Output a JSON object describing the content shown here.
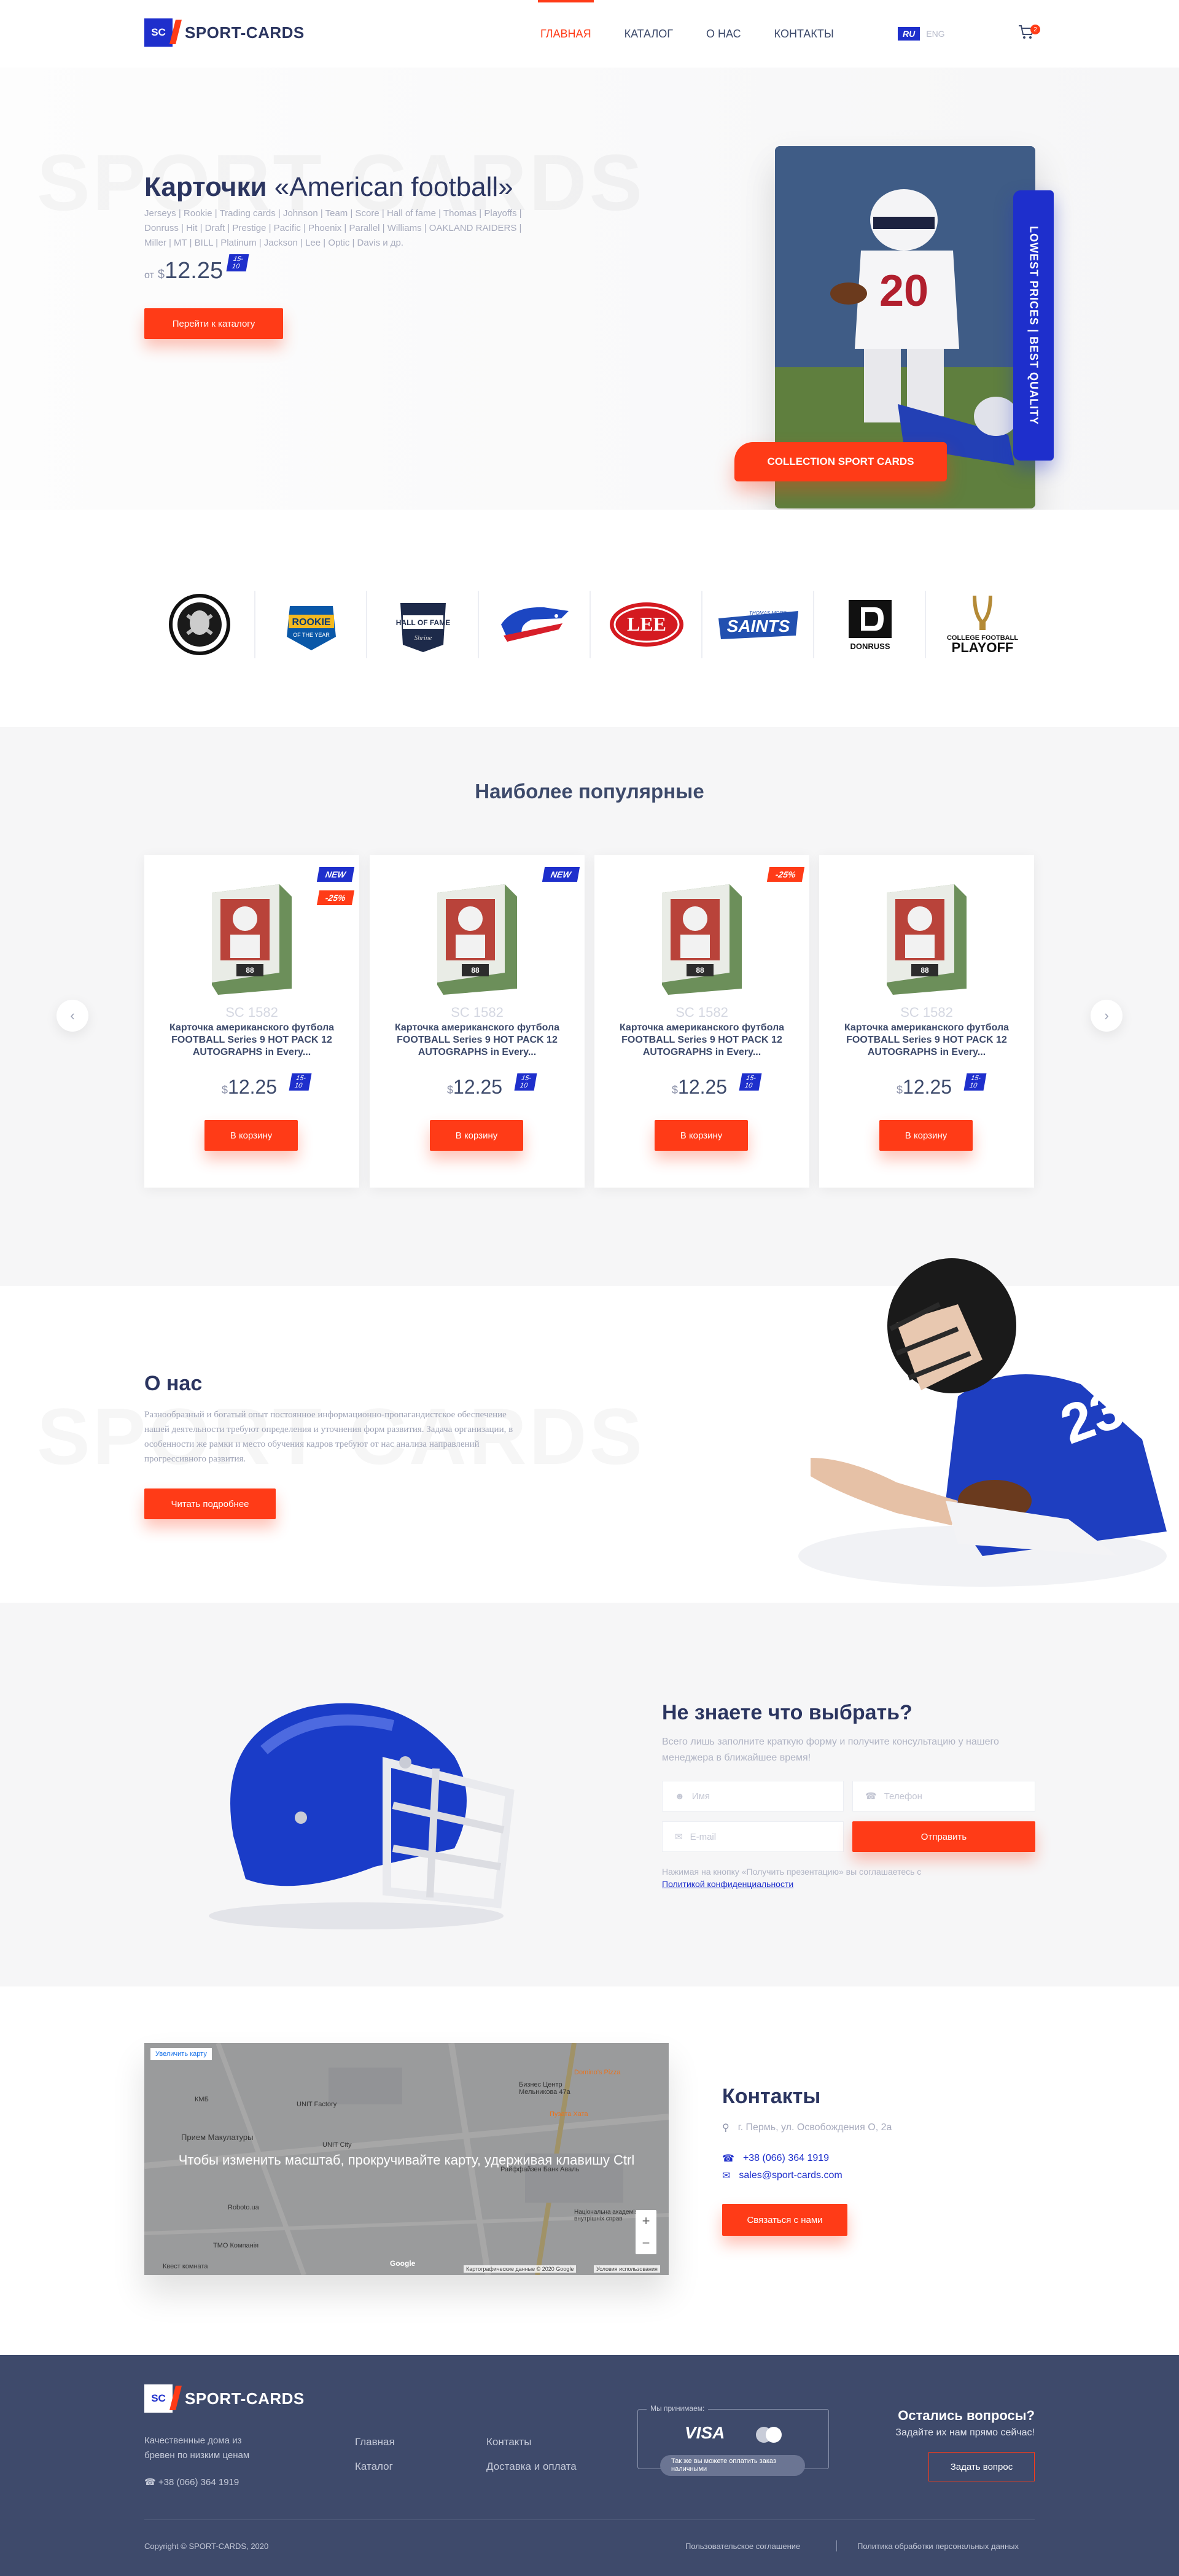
{
  "header": {
    "logo_mark": "SC",
    "logo_text": "SPORT-CARDS",
    "nav": [
      "ГЛАВНАЯ",
      "КАТАЛОГ",
      "О НАС",
      "КОНТАКТЫ"
    ],
    "active_nav": "ГЛАВНАЯ",
    "lang_active": "RU",
    "lang_inactive": "ENG",
    "cart_count": "2",
    "colors": {
      "accent": "#ff3b17",
      "brand": "#1e2fcc",
      "text": "#3d4a6b"
    }
  },
  "hero": {
    "bg_word": "SPORT CARDS",
    "title": "Карточки",
    "title_quote": "«American football»",
    "tags": "Jerseys | Rookie | Trading cards | Johnson | Team | Score | Hall of fame | Thomas | Playoffs | Donruss | Hit | Draft | Prestige | Pacific | Phoenix | Parallel | Williams | OAKLAND RAIDERS | Miller | MT | BILL | Platinum | Jackson | Lee | Optic | Davis и др.",
    "price_from": "от",
    "price_currency": "$",
    "price_value": "12.25",
    "price_tag": "15-10",
    "button": "Перейти к каталогу",
    "badge_vertical": "LOWEST PRICES | BEST QUALITY",
    "collection_button": "COLLECTION SPORT CARDS"
  },
  "brands": [
    {
      "name": "RAIDERS",
      "icon": "raiders-logo"
    },
    {
      "name": "ROOKIE OF THE YEAR",
      "icon": "rookie-logo"
    },
    {
      "name": "HALL OF FAME",
      "icon": "hall-of-fame-logo"
    },
    {
      "name": "BILLS",
      "icon": "bills-logo"
    },
    {
      "name": "LEE",
      "icon": "lee-logo"
    },
    {
      "name": "SAINTS",
      "icon": "saints-logo"
    },
    {
      "name": "DONRUSS",
      "icon": "donruss-logo"
    },
    {
      "name": "COLLEGE FOOTBALL PLAYOFF",
      "icon": "cfp-logo"
    }
  ],
  "popular": {
    "title": "Наиболее популярные",
    "products": [
      {
        "sku": "SC 1582",
        "name": "Карточка американского футбола FOOTBALL Series 9 HOT PACK 12 AUTOGRAPHS in Every...",
        "currency": "$",
        "price": "12.25",
        "tag": "15-10",
        "badges": [
          "NEW",
          "-25%"
        ],
        "button": "В корзину"
      },
      {
        "sku": "SC 1582",
        "name": "Карточка американского футбола FOOTBALL Series 9 HOT PACK 12 AUTOGRAPHS in Every...",
        "currency": "$",
        "price": "12.25",
        "tag": "15-10",
        "badges": [
          "NEW"
        ],
        "button": "В корзину"
      },
      {
        "sku": "SC 1582",
        "name": "Карточка американского футбола FOOTBALL Series 9 HOT PACK 12 AUTOGRAPHS in Every...",
        "currency": "$",
        "price": "12.25",
        "tag": "15-10",
        "badges": [
          "-25%"
        ],
        "button": "В корзину"
      },
      {
        "sku": "SC 1582",
        "name": "Карточка американского футбола FOOTBALL Series 9 HOT PACK 12 AUTOGRAPHS in Every...",
        "currency": "$",
        "price": "12.25",
        "tag": "15-10",
        "badges": [],
        "button": "В корзину"
      }
    ]
  },
  "about": {
    "bg_word": "SPORT CARDS",
    "title": "О нас",
    "text": "Разнообразный и богатый опыт постоянное информационно-пропагандистское обеспечение нашей деятельности требуют определения и уточнения форм развития. Задача организации, в особенности же рамки и место обучения кадров требуют от нас анализа направлений прогрессивного развития.",
    "button": "Читать подробнее"
  },
  "consult": {
    "title": "Не знаете что выбрать?",
    "subtitle": "Всего лишь заполните краткую форму и получите консультацию у нашего менеджера в ближайшее время!",
    "name_placeholder": "Имя",
    "phone_placeholder": "Телефон",
    "email_placeholder": "E-mail",
    "submit": "Отправить",
    "note": "Нажимая на кнопку «Получить презентацию» вы соглашаетесь с",
    "note_link": "Политикой конфиденциальности"
  },
  "contacts": {
    "title": "Контакты",
    "address": "г. Пермь, ул. Освобождения О, 2а",
    "phone": "+38 (066) 364 1919",
    "email": "sales@sport-cards.com",
    "button": "Связаться с нами",
    "map": {
      "enlarge": "Увеличить карту",
      "hint": "Чтобы изменить масштаб, прокручивайте карту, удерживая клавишу Ctrl",
      "labels": [
        "Бизнес Центр Мельникова 47а",
        "Domino's Pizza",
        "UNIT Factory",
        "Пузата Хата",
        "КМБ",
        "Прием Макулатуры",
        "UNIT City",
        "Райффайзен Банк Аваль",
        "Roboto.ua",
        "ТМО Компанія",
        "Національна академія внутрішніх справ",
        "Квест комната"
      ],
      "attribution": "Картографические данные © 2020 Google",
      "terms": "Условия использования",
      "google": "Google"
    }
  },
  "footer": {
    "logo_mark": "SC",
    "logo_text": "SPORT-CARDS",
    "desc": "Качественные дома из бревен по низким ценам",
    "phone": "+38 (066) 364 1919",
    "links_col1": [
      "Главная",
      "Каталог"
    ],
    "links_col2": [
      "Контакты",
      "Доставка и оплата"
    ],
    "pay_label": "Мы принимаем:",
    "pay_visa": "VISA",
    "pay_note": "Так же вы можете оплатить заказ наличными",
    "questions_title": "Остались вопросы?",
    "questions_sub": "Задайте их нам прямо сейчас!",
    "questions_button": "Задать вопрос",
    "copyright": "Copyright © SPORT-CARDS, 2020",
    "terms": "Пользовательское соглашение",
    "privacy": "Политика обработки персональных данных"
  }
}
